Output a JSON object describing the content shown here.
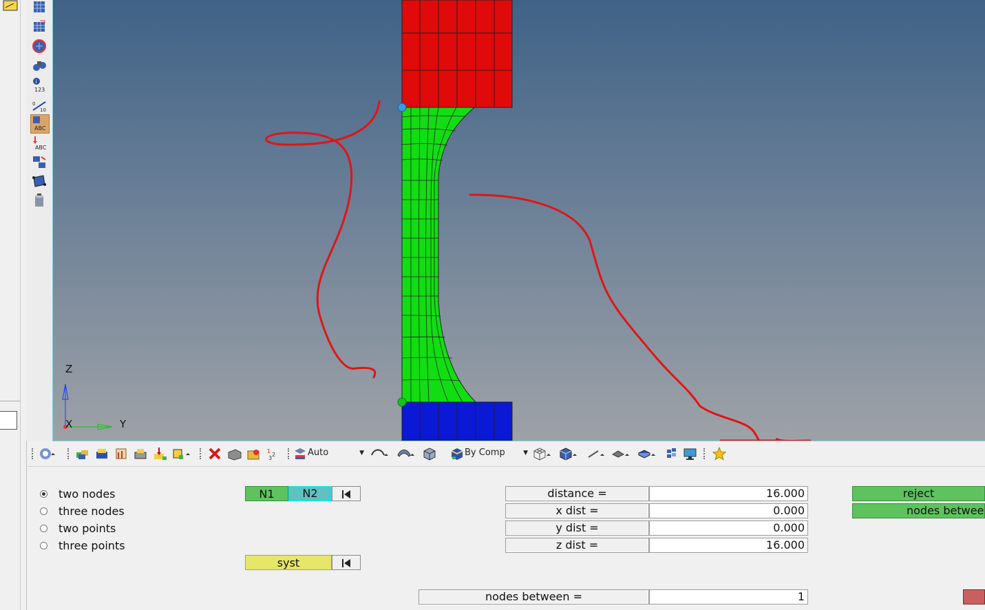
{
  "toolbar": {
    "visual_mode_value": "Auto",
    "color_mode_value": "By Comp"
  },
  "axes": {
    "z": "Z",
    "x": "X",
    "y": "Y"
  },
  "panel": {
    "options": [
      {
        "label": "two nodes",
        "selected": true
      },
      {
        "label": "three nodes",
        "selected": false
      },
      {
        "label": "two points",
        "selected": false
      },
      {
        "label": "three points",
        "selected": false
      }
    ],
    "n1_label": "N1",
    "n2_label": "N2",
    "syst_label": "syst",
    "distance_label": "distance =",
    "distance_value": "16.000",
    "xdist_label": "x dist   =",
    "xdist_value": "0.000",
    "ydist_label": "y dist   =",
    "ydist_value": "0.000",
    "zdist_label": "z dist   =",
    "zdist_value": "16.000",
    "nodes_between_label": "nodes between  =",
    "nodes_between_value": "1",
    "reject_label": "reject",
    "nodes_between_button_label": "nodes  betwee"
  },
  "colors": {
    "top_part": "#e00a0a",
    "middle_part": "#12dd12",
    "bottom_part": "#0b18d6",
    "annotation": "#e01515",
    "n1_button": "#5ec35e",
    "n2_button": "#5fc1c1",
    "syst_button": "#e6e66a"
  }
}
